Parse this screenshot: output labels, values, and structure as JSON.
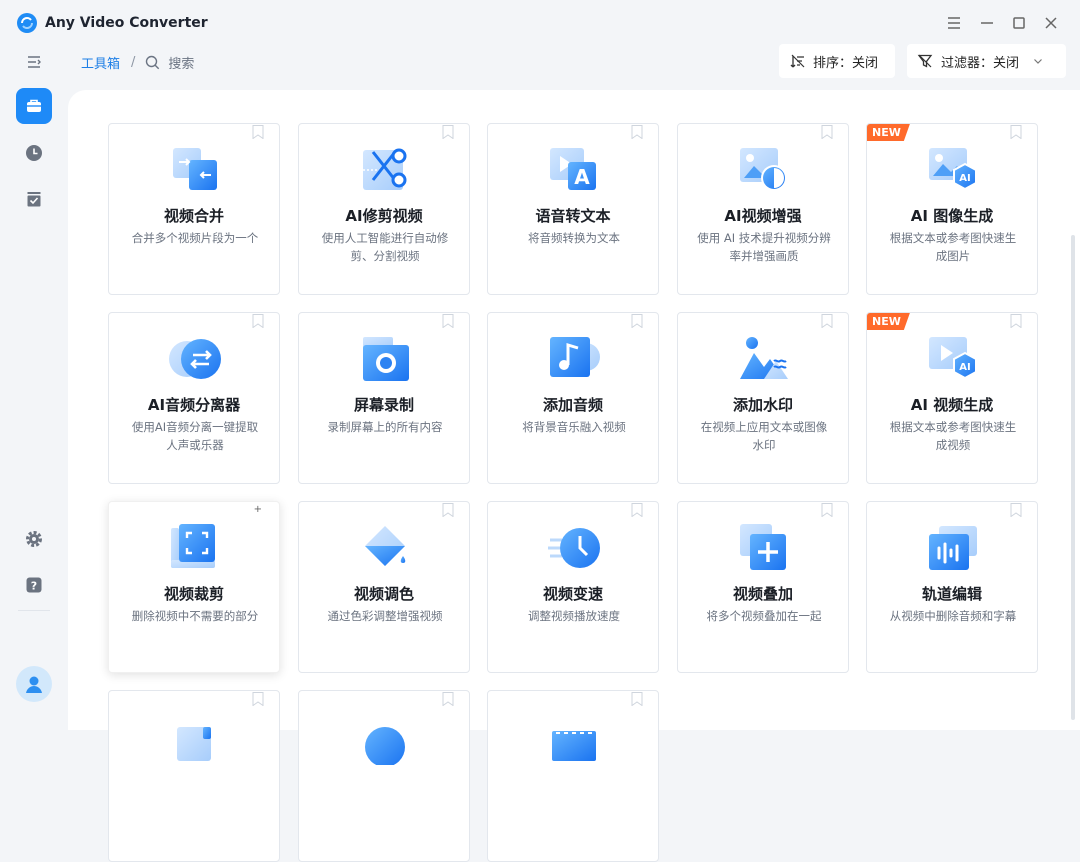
{
  "app": {
    "title": "Any Video Converter"
  },
  "breadcrumb": {
    "home": "工具箱",
    "separator": "/",
    "search_label": "搜索"
  },
  "controls": {
    "sort_label": "排序：关闭",
    "filter_label": "过滤器：关闭"
  },
  "badge_new": "NEW",
  "colors": {
    "accent": "#1e8af7",
    "badge": "#ff6a2b"
  },
  "tools": [
    {
      "title": "视频合并",
      "desc": "合并多个视频片段为一个",
      "icon": "merge-icon"
    },
    {
      "title": "AI修剪视频",
      "desc": "使用人工智能进行自动修剪、分割视频",
      "icon": "scissors-icon"
    },
    {
      "title": "语音转文本",
      "desc": "将音频转换为文本",
      "icon": "speech-to-text-icon"
    },
    {
      "title": "AI视频增强",
      "desc": "使用 AI 技术提升视频分辨率并增强画质",
      "icon": "enhance-icon"
    },
    {
      "title": "AI 图像生成",
      "desc": "根据文本或参考图快速生成图片",
      "icon": "ai-image-icon",
      "badge": true
    },
    {
      "title": "AI音频分离器",
      "desc": "使用AI音频分离一键提取人声或乐器",
      "icon": "audio-separator-icon"
    },
    {
      "title": "屏幕录制",
      "desc": "录制屏幕上的所有内容",
      "icon": "screen-record-icon"
    },
    {
      "title": "添加音频",
      "desc": "将背景音乐融入视频",
      "icon": "music-note-icon"
    },
    {
      "title": "添加水印",
      "desc": "在视频上应用文本或图像水印",
      "icon": "watermark-icon"
    },
    {
      "title": "AI 视频生成",
      "desc": "根据文本或参考图快速生成视频",
      "icon": "ai-video-icon",
      "badge": true
    },
    {
      "title": "视频裁剪",
      "desc": "删除视频中不需要的部分",
      "icon": "crop-icon",
      "hover": true
    },
    {
      "title": "视频调色",
      "desc": "通过色彩调整增强视频",
      "icon": "paint-bucket-icon"
    },
    {
      "title": "视频变速",
      "desc": "调整视频播放速度",
      "icon": "speed-clock-icon"
    },
    {
      "title": "视频叠加",
      "desc": "将多个视频叠加在一起",
      "icon": "overlay-icon"
    },
    {
      "title": "轨道编辑",
      "desc": "从视频中删除音频和字幕",
      "icon": "track-edit-icon"
    },
    {
      "title": "",
      "desc": "",
      "icon": "partial-icon-1"
    },
    {
      "title": "",
      "desc": "",
      "icon": "partial-icon-2"
    },
    {
      "title": "",
      "desc": "",
      "icon": "partial-icon-3"
    }
  ]
}
